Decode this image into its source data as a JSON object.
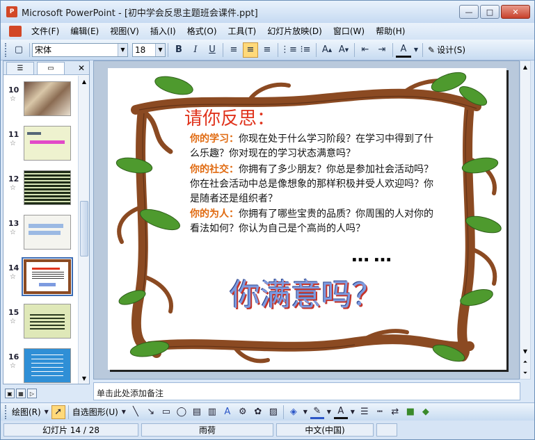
{
  "window": {
    "title": "Microsoft PowerPoint - [初中学会反思主题班会课件.ppt]",
    "app_icon": "P",
    "minimize": "—",
    "maximize": "□",
    "close": "✕"
  },
  "menu": {
    "items": [
      "文件(F)",
      "编辑(E)",
      "视图(V)",
      "插入(I)",
      "格式(O)",
      "工具(T)",
      "幻灯片放映(D)",
      "窗口(W)",
      "帮助(H)"
    ]
  },
  "toolbar": {
    "font_name": "宋体",
    "font_size": "18",
    "bold": "B",
    "italic": "I",
    "underline": "U",
    "design_label": "设计(S)"
  },
  "slides_pane": {
    "tabs": [
      "outline",
      "slides"
    ],
    "close": "✕",
    "thumbs": [
      {
        "num": "10",
        "star": "☆"
      },
      {
        "num": "11",
        "star": "☆"
      },
      {
        "num": "12",
        "star": "☆"
      },
      {
        "num": "13",
        "star": "☆"
      },
      {
        "num": "14",
        "star": "☆"
      },
      {
        "num": "15",
        "star": "☆"
      },
      {
        "num": "16",
        "star": "☆"
      }
    ]
  },
  "slide": {
    "title": "请你反思：",
    "paragraphs": [
      {
        "lead": "你的学习：",
        "text": "你现在处于什么学习阶段？在学习中得到了什么乐趣？你对现在的学习状态满意吗？"
      },
      {
        "lead": "你的社交：",
        "text": "你拥有了多少朋友？你总是参加社会活动吗？你在社会活动中总是像想象的那样积极并受人欢迎吗？你是随者还是组织者？"
      },
      {
        "lead": "你的为人：",
        "text": "你拥有了哪些宝贵的品质？你周围的人对你的看法如何？你认为自己是个高尚的人吗？"
      }
    ],
    "dots": "……",
    "big_question": "你满意吗？"
  },
  "notes": {
    "placeholder": "单击此处添加备注"
  },
  "drawbar": {
    "draw_label": "绘图(R)",
    "autoshape_label": "自选图形(U)"
  },
  "status": {
    "slide_position": "幻灯片 14 / 28",
    "design": "雨荷",
    "language": "中文(中国)"
  },
  "colors": {
    "accent": "#e0331c",
    "lead": "#e06a10",
    "branch": "#8b4a22",
    "leaf": "#4e9a2e"
  }
}
